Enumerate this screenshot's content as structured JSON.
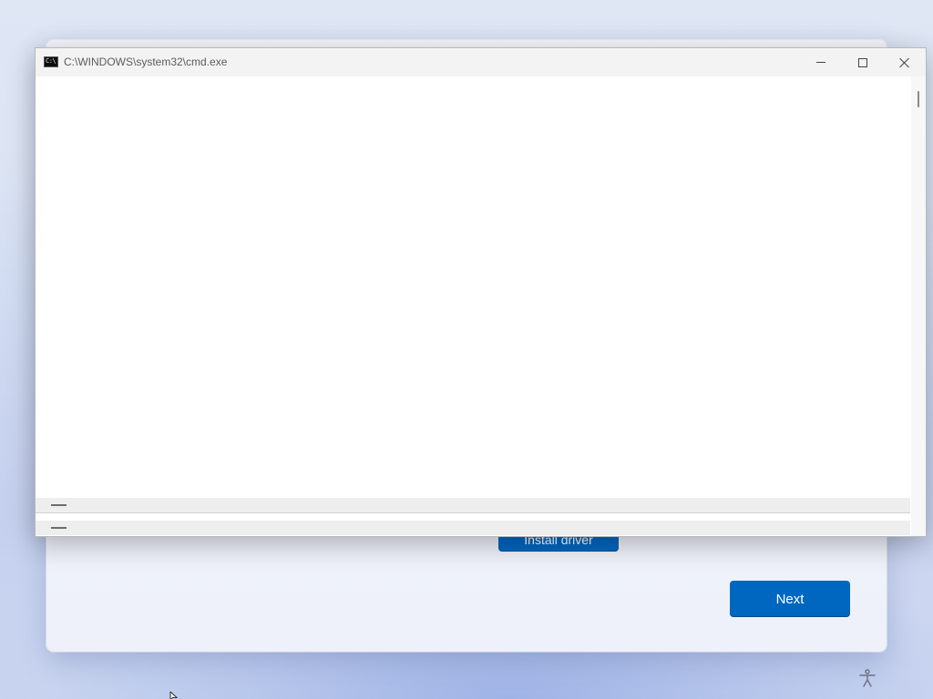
{
  "setup": {
    "install_button_label": "Install driver",
    "next_button_label": "Next"
  },
  "cmd_window": {
    "title": "C:\\WINDOWS\\system32\\cmd.exe",
    "icon_text": "C:\\",
    "icon": "cmd-icon",
    "controls": {
      "minimize_icon": "minimize-icon",
      "maximize_icon": "maximize-icon",
      "close_icon": "close-icon"
    }
  },
  "accessibility_icon": "accessibility-icon",
  "colors": {
    "accent_button": "#0067c0",
    "console_background": "#ffffff",
    "titlebar_background": "#f3f3f3"
  }
}
